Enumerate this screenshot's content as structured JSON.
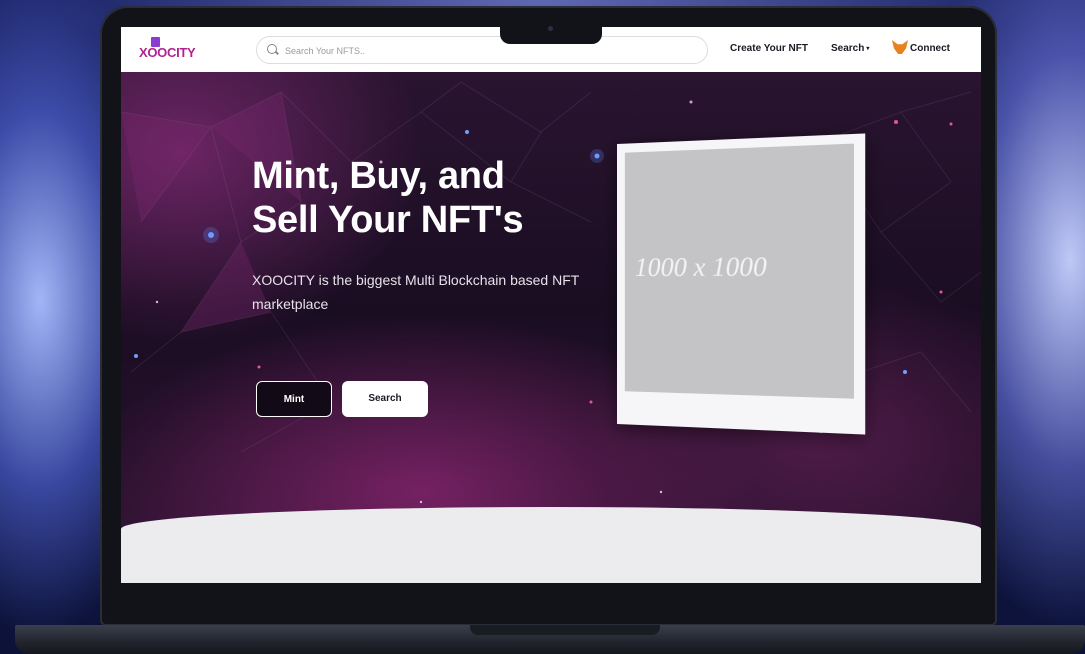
{
  "brand": {
    "name": "XOOCITY",
    "logo_color": "#b0238f",
    "logo_mark_color": "#8a3bd1"
  },
  "navbar": {
    "search_placeholder": "Search Your NFTS..",
    "search_icon": "search-icon",
    "links": {
      "create": "Create Your NFT",
      "search": "Search",
      "search_caret": "▾",
      "connect": "Connect"
    },
    "connect_icon": "metamask-fox-icon"
  },
  "hero": {
    "title_line1": "Mint, Buy, and",
    "title_line2": "Sell Your NFT's",
    "subtitle": "XOOCITY is the biggest Multi Blockchain based NFT marketplace",
    "buttons": {
      "mint": "Mint",
      "search": "Search"
    },
    "nft_placeholder": "1000 x 1000"
  },
  "colors": {
    "hero_bg": "#1a0d22",
    "accent_pink": "#b0238f",
    "text_light": "#ffffff"
  }
}
